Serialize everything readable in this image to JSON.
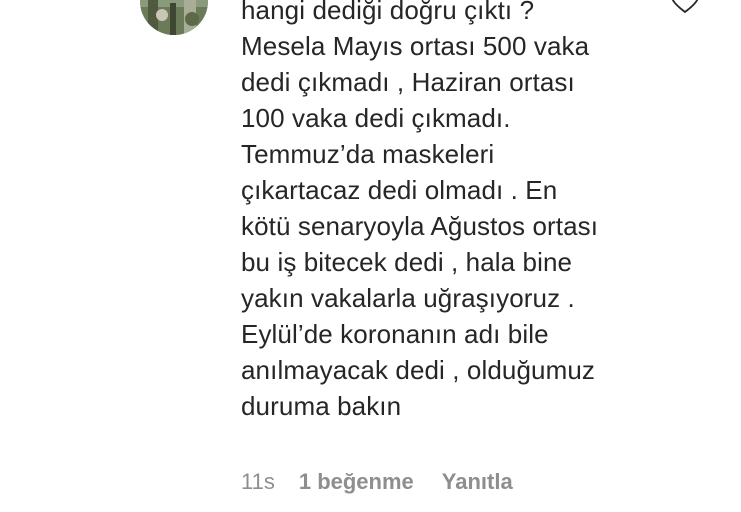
{
  "comment": {
    "text": "hangi dediği doğru çıktı ?\nMesela Mayıs ortası 500 vaka\ndedi çıkmadı , Haziran ortası\n100 vaka dedi çıkmadı.\nTemmuz’da maskeleri\nçıkartacaz dedi olmadı . En\nkötü senaryoyla Ağustos ortası\nbu iş bitecek dedi , hala bine\nyakın vakalarla uğraşıyoruz .\nEylül’de koronanın adı bile\nanılmayacak dedi , olduğumuz\nduruma bakın",
    "time": "11s",
    "likes_label": "1 beğenme",
    "reply_label": "Yanıtla"
  },
  "icons": {
    "avatar": "avatar-photo",
    "like": "heart-outline-icon"
  },
  "colors": {
    "text": "#262626",
    "secondary": "#8e8e8e"
  }
}
